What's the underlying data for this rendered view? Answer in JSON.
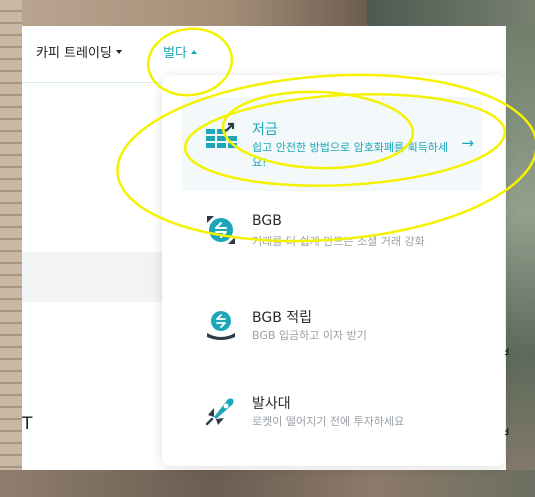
{
  "nav": {
    "copy_trading": "카피 트레이딩",
    "earn": "벌다"
  },
  "menu": {
    "items": [
      {
        "title": "저금",
        "desc": "쉽고 안전한 방법으로 암호화폐를 획득하세요!",
        "icon": "savings-icon",
        "active": true
      },
      {
        "title": "BGB",
        "desc": "거래를 더 쉽게 만드는 소셜 거래 강화",
        "icon": "bgb-coin-icon",
        "active": false
      },
      {
        "title": "BGB 적립",
        "desc": "BGB 입금하고 이자 받기",
        "icon": "bgb-earn-icon",
        "active": false
      },
      {
        "title": "발사대",
        "desc": "로켓이 떨어지기 전에 투자하세요",
        "icon": "rocket-icon",
        "active": false
      }
    ]
  },
  "page": {
    "partial_letter": "T"
  },
  "colors": {
    "accent": "#1ba7b8",
    "annotation": "#f5f200"
  }
}
